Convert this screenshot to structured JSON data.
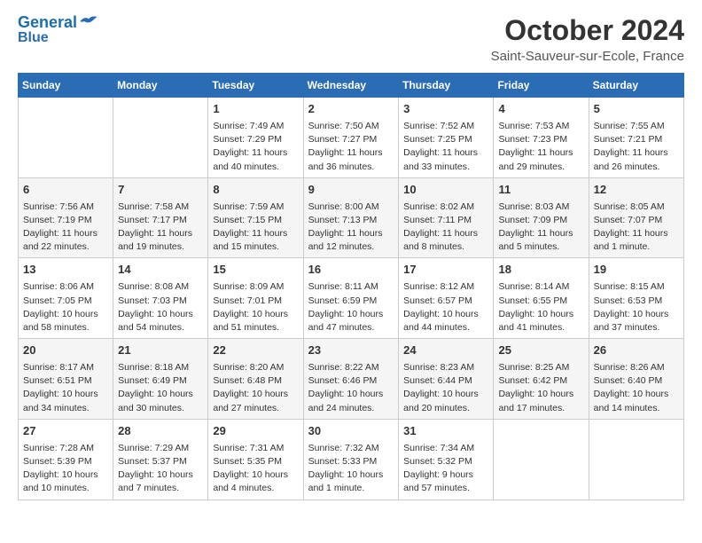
{
  "header": {
    "logo_line1": "General",
    "logo_line2": "Blue",
    "month": "October 2024",
    "location": "Saint-Sauveur-sur-Ecole, France"
  },
  "columns": [
    "Sunday",
    "Monday",
    "Tuesday",
    "Wednesday",
    "Thursday",
    "Friday",
    "Saturday"
  ],
  "weeks": [
    [
      {
        "day": "",
        "content": ""
      },
      {
        "day": "",
        "content": ""
      },
      {
        "day": "1",
        "content": "Sunrise: 7:49 AM\nSunset: 7:29 PM\nDaylight: 11 hours and 40 minutes."
      },
      {
        "day": "2",
        "content": "Sunrise: 7:50 AM\nSunset: 7:27 PM\nDaylight: 11 hours and 36 minutes."
      },
      {
        "day": "3",
        "content": "Sunrise: 7:52 AM\nSunset: 7:25 PM\nDaylight: 11 hours and 33 minutes."
      },
      {
        "day": "4",
        "content": "Sunrise: 7:53 AM\nSunset: 7:23 PM\nDaylight: 11 hours and 29 minutes."
      },
      {
        "day": "5",
        "content": "Sunrise: 7:55 AM\nSunset: 7:21 PM\nDaylight: 11 hours and 26 minutes."
      }
    ],
    [
      {
        "day": "6",
        "content": "Sunrise: 7:56 AM\nSunset: 7:19 PM\nDaylight: 11 hours and 22 minutes."
      },
      {
        "day": "7",
        "content": "Sunrise: 7:58 AM\nSunset: 7:17 PM\nDaylight: 11 hours and 19 minutes."
      },
      {
        "day": "8",
        "content": "Sunrise: 7:59 AM\nSunset: 7:15 PM\nDaylight: 11 hours and 15 minutes."
      },
      {
        "day": "9",
        "content": "Sunrise: 8:00 AM\nSunset: 7:13 PM\nDaylight: 11 hours and 12 minutes."
      },
      {
        "day": "10",
        "content": "Sunrise: 8:02 AM\nSunset: 7:11 PM\nDaylight: 11 hours and 8 minutes."
      },
      {
        "day": "11",
        "content": "Sunrise: 8:03 AM\nSunset: 7:09 PM\nDaylight: 11 hours and 5 minutes."
      },
      {
        "day": "12",
        "content": "Sunrise: 8:05 AM\nSunset: 7:07 PM\nDaylight: 11 hours and 1 minute."
      }
    ],
    [
      {
        "day": "13",
        "content": "Sunrise: 8:06 AM\nSunset: 7:05 PM\nDaylight: 10 hours and 58 minutes."
      },
      {
        "day": "14",
        "content": "Sunrise: 8:08 AM\nSunset: 7:03 PM\nDaylight: 10 hours and 54 minutes."
      },
      {
        "day": "15",
        "content": "Sunrise: 8:09 AM\nSunset: 7:01 PM\nDaylight: 10 hours and 51 minutes."
      },
      {
        "day": "16",
        "content": "Sunrise: 8:11 AM\nSunset: 6:59 PM\nDaylight: 10 hours and 47 minutes."
      },
      {
        "day": "17",
        "content": "Sunrise: 8:12 AM\nSunset: 6:57 PM\nDaylight: 10 hours and 44 minutes."
      },
      {
        "day": "18",
        "content": "Sunrise: 8:14 AM\nSunset: 6:55 PM\nDaylight: 10 hours and 41 minutes."
      },
      {
        "day": "19",
        "content": "Sunrise: 8:15 AM\nSunset: 6:53 PM\nDaylight: 10 hours and 37 minutes."
      }
    ],
    [
      {
        "day": "20",
        "content": "Sunrise: 8:17 AM\nSunset: 6:51 PM\nDaylight: 10 hours and 34 minutes."
      },
      {
        "day": "21",
        "content": "Sunrise: 8:18 AM\nSunset: 6:49 PM\nDaylight: 10 hours and 30 minutes."
      },
      {
        "day": "22",
        "content": "Sunrise: 8:20 AM\nSunset: 6:48 PM\nDaylight: 10 hours and 27 minutes."
      },
      {
        "day": "23",
        "content": "Sunrise: 8:22 AM\nSunset: 6:46 PM\nDaylight: 10 hours and 24 minutes."
      },
      {
        "day": "24",
        "content": "Sunrise: 8:23 AM\nSunset: 6:44 PM\nDaylight: 10 hours and 20 minutes."
      },
      {
        "day": "25",
        "content": "Sunrise: 8:25 AM\nSunset: 6:42 PM\nDaylight: 10 hours and 17 minutes."
      },
      {
        "day": "26",
        "content": "Sunrise: 8:26 AM\nSunset: 6:40 PM\nDaylight: 10 hours and 14 minutes."
      }
    ],
    [
      {
        "day": "27",
        "content": "Sunrise: 7:28 AM\nSunset: 5:39 PM\nDaylight: 10 hours and 10 minutes."
      },
      {
        "day": "28",
        "content": "Sunrise: 7:29 AM\nSunset: 5:37 PM\nDaylight: 10 hours and 7 minutes."
      },
      {
        "day": "29",
        "content": "Sunrise: 7:31 AM\nSunset: 5:35 PM\nDaylight: 10 hours and 4 minutes."
      },
      {
        "day": "30",
        "content": "Sunrise: 7:32 AM\nSunset: 5:33 PM\nDaylight: 10 hours and 1 minute."
      },
      {
        "day": "31",
        "content": "Sunrise: 7:34 AM\nSunset: 5:32 PM\nDaylight: 9 hours and 57 minutes."
      },
      {
        "day": "",
        "content": ""
      },
      {
        "day": "",
        "content": ""
      }
    ]
  ]
}
